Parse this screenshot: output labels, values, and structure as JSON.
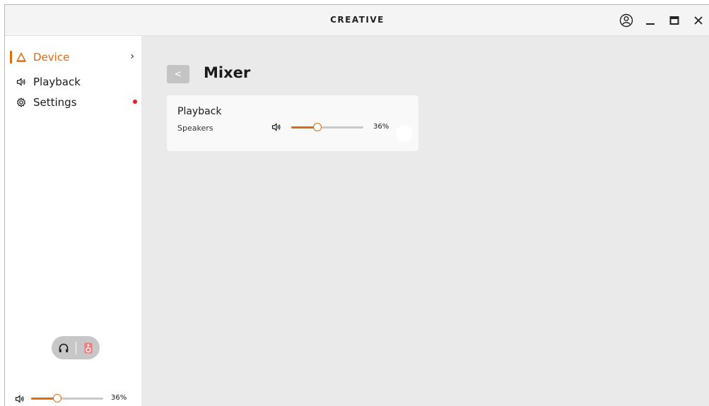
{
  "app": {
    "logo": "CREATIVE"
  },
  "sidebar": {
    "items": [
      {
        "label": "Device",
        "icon": "device-triangle-icon",
        "active": true,
        "has_chevron": true
      },
      {
        "label": "Playback",
        "icon": "speaker-icon"
      },
      {
        "label": "Settings",
        "icon": "gear-icon",
        "has_notification": true
      }
    ],
    "output_toggle": {
      "options": [
        "headphones-icon",
        "speaker-box-icon"
      ],
      "selected": "speaker-box-icon"
    },
    "master_volume": {
      "value": 36,
      "label": "36%"
    }
  },
  "main": {
    "title": "Mixer",
    "back_label": "<",
    "card": {
      "title": "Playback",
      "device": "Speakers",
      "volume": {
        "value": 36,
        "label": "36%"
      }
    }
  },
  "colors": {
    "accent": "#e06a0f",
    "notification": "#e52020"
  }
}
